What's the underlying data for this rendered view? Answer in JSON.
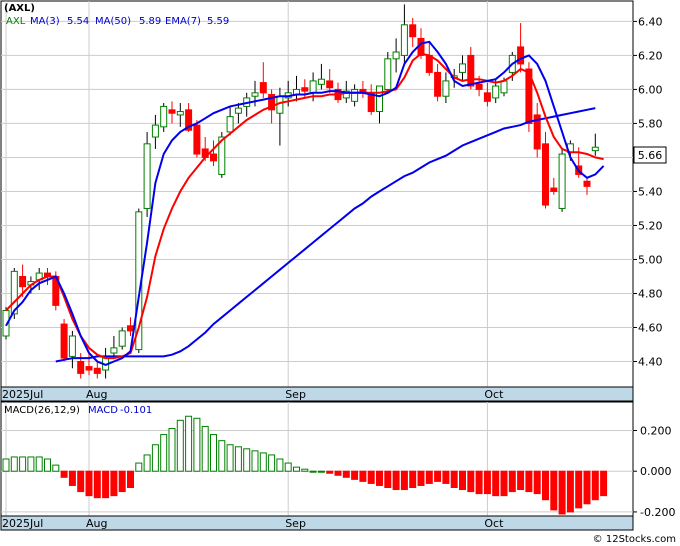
{
  "chart_data": [
    {
      "type": "candlestick",
      "title": "(AXL)",
      "x_labels": [
        "2025Jul",
        "Aug",
        "Sep",
        "Oct"
      ],
      "y_ticks": [
        4.4,
        4.6,
        4.8,
        5.0,
        5.2,
        5.4,
        5.6,
        5.8,
        6.0,
        6.2,
        6.4
      ],
      "ylim": [
        4.25,
        6.52
      ],
      "legend": [
        {
          "name": "AXL",
          "color": "#008000"
        },
        {
          "name": "MA(3)",
          "value": "5.54",
          "color": "#0000cc"
        },
        {
          "name": "MA(50)",
          "value": "5.89",
          "color": "#0000cc"
        },
        {
          "name": "EMA(7)",
          "value": "5.59",
          "color": "#0000cc"
        }
      ],
      "last_price": "5.66",
      "colors": {
        "up": "#008000",
        "down": "#ff0000",
        "ma": "#0000ee",
        "ema": "#ff0000",
        "grid": "#cccccc",
        "axis_band": "#bfd8e8"
      },
      "ohlc": [
        [
          4.55,
          4.72,
          4.53,
          4.7
        ],
        [
          4.68,
          4.95,
          4.65,
          4.93
        ],
        [
          4.9,
          4.97,
          4.78,
          4.84
        ],
        [
          4.85,
          4.9,
          4.8,
          4.87
        ],
        [
          4.88,
          4.95,
          4.82,
          4.92
        ],
        [
          4.92,
          4.95,
          4.85,
          4.9
        ],
        [
          4.9,
          4.93,
          4.7,
          4.73
        ],
        [
          4.62,
          4.65,
          4.4,
          4.42
        ],
        [
          4.43,
          4.58,
          4.36,
          4.55
        ],
        [
          4.4,
          4.45,
          4.3,
          4.33
        ],
        [
          4.37,
          4.45,
          4.32,
          4.35
        ],
        [
          4.36,
          4.4,
          4.3,
          4.33
        ],
        [
          4.35,
          4.48,
          4.3,
          4.42
        ],
        [
          4.45,
          4.55,
          4.42,
          4.48
        ],
        [
          4.49,
          4.6,
          4.47,
          4.58
        ],
        [
          4.61,
          4.66,
          4.55,
          4.58
        ],
        [
          4.47,
          5.3,
          4.45,
          5.28
        ],
        [
          5.3,
          5.75,
          5.25,
          5.68
        ],
        [
          5.72,
          5.85,
          5.65,
          5.79
        ],
        [
          5.78,
          5.92,
          5.75,
          5.9
        ],
        [
          5.88,
          5.93,
          5.8,
          5.86
        ],
        [
          5.85,
          5.92,
          5.78,
          5.87
        ],
        [
          5.88,
          5.92,
          5.75,
          5.76
        ],
        [
          5.79,
          5.82,
          5.6,
          5.62
        ],
        [
          5.65,
          5.72,
          5.58,
          5.6
        ],
        [
          5.62,
          5.7,
          5.55,
          5.58
        ],
        [
          5.5,
          5.75,
          5.48,
          5.72
        ],
        [
          5.75,
          5.9,
          5.73,
          5.84
        ],
        [
          5.86,
          5.92,
          5.8,
          5.89
        ],
        [
          5.9,
          5.98,
          5.84,
          5.95
        ],
        [
          5.96,
          6.05,
          5.9,
          5.98
        ],
        [
          6.04,
          6.16,
          5.95,
          5.98
        ],
        [
          5.97,
          6.0,
          5.8,
          5.88
        ],
        [
          5.86,
          6.01,
          5.67,
          5.96
        ],
        [
          5.95,
          6.05,
          5.9,
          5.98
        ],
        [
          5.97,
          6.08,
          5.93,
          6.0
        ],
        [
          6.01,
          6.06,
          5.95,
          5.99
        ],
        [
          5.98,
          6.1,
          5.93,
          6.05
        ],
        [
          6.03,
          6.15,
          6.0,
          6.06
        ],
        [
          6.05,
          6.12,
          5.98,
          6.01
        ],
        [
          6.0,
          6.04,
          5.92,
          5.94
        ],
        [
          5.95,
          6.05,
          5.92,
          5.99
        ],
        [
          5.93,
          6.03,
          5.9,
          6.0
        ],
        [
          6.0,
          6.05,
          5.95,
          5.98
        ],
        [
          5.98,
          6.03,
          5.85,
          5.87
        ],
        [
          5.87,
          6.02,
          5.8,
          6.02
        ],
        [
          6.0,
          6.22,
          5.98,
          6.18
        ],
        [
          6.18,
          6.3,
          6.1,
          6.22
        ],
        [
          6.2,
          6.5,
          6.15,
          6.38
        ],
        [
          6.38,
          6.42,
          6.25,
          6.31
        ],
        [
          6.3,
          6.36,
          6.18,
          6.2
        ],
        [
          6.2,
          6.28,
          6.08,
          6.1
        ],
        [
          6.1,
          6.15,
          5.93,
          5.96
        ],
        [
          5.96,
          6.1,
          5.92,
          6.05
        ],
        [
          6.07,
          6.12,
          6.01,
          6.08
        ],
        [
          6.1,
          6.2,
          6.05,
          6.15
        ],
        [
          6.2,
          6.25,
          6.0,
          6.02
        ],
        [
          6.03,
          6.08,
          5.96,
          6.0
        ],
        [
          5.98,
          6.04,
          5.9,
          5.93
        ],
        [
          5.95,
          6.06,
          5.92,
          6.02
        ],
        [
          5.98,
          6.07,
          5.96,
          6.05
        ],
        [
          6.1,
          6.22,
          6.05,
          6.2
        ],
        [
          6.25,
          6.39,
          6.1,
          6.15
        ],
        [
          6.12,
          6.16,
          5.75,
          5.8
        ],
        [
          5.85,
          5.92,
          5.6,
          5.65
        ],
        [
          5.68,
          5.75,
          5.3,
          5.32
        ],
        [
          5.42,
          5.48,
          5.38,
          5.4
        ],
        [
          5.3,
          5.65,
          5.28,
          5.62
        ],
        [
          5.63,
          5.7,
          5.58,
          5.68
        ],
        [
          5.55,
          5.66,
          5.48,
          5.5
        ],
        [
          5.46,
          5.48,
          5.38,
          5.43
        ],
        [
          5.64,
          5.74,
          5.61,
          5.66
        ]
      ],
      "ma3": [
        4.61,
        4.7,
        4.75,
        4.82,
        4.86,
        4.88,
        4.9,
        4.8,
        4.68,
        4.55,
        4.45,
        4.4,
        4.38,
        4.4,
        4.42,
        4.46,
        4.78,
        5.1,
        5.45,
        5.62,
        5.7,
        5.75,
        5.78,
        5.8,
        5.83,
        5.86,
        5.88,
        5.9,
        5.91,
        5.92,
        5.93,
        5.94,
        5.95,
        5.96,
        5.96,
        5.97,
        5.97,
        5.98,
        5.98,
        5.99,
        5.99,
        5.98,
        5.98,
        5.98,
        5.97,
        5.96,
        5.98,
        6.01,
        6.15,
        6.22,
        6.27,
        6.28,
        6.22,
        6.15,
        6.05,
        6.02,
        6.03,
        6.04,
        6.05,
        6.06,
        6.1,
        6.15,
        6.18,
        6.2,
        6.15,
        6.05,
        5.9,
        5.75,
        5.6,
        5.52,
        5.48,
        5.5,
        5.55
      ],
      "ma50": [
        4.4,
        4.41,
        4.42,
        4.42,
        4.42,
        4.43,
        4.43,
        4.43,
        4.43,
        4.43,
        4.43,
        4.43,
        4.43,
        4.43,
        4.44,
        4.46,
        4.49,
        4.53,
        4.57,
        4.62,
        4.66,
        4.7,
        4.74,
        4.78,
        4.82,
        4.86,
        4.9,
        4.94,
        4.98,
        5.02,
        5.06,
        5.1,
        5.14,
        5.18,
        5.22,
        5.26,
        5.3,
        5.33,
        5.37,
        5.4,
        5.43,
        5.46,
        5.49,
        5.51,
        5.54,
        5.57,
        5.59,
        5.61,
        5.64,
        5.67,
        5.69,
        5.71,
        5.73,
        5.75,
        5.77,
        5.78,
        5.79,
        5.81,
        5.82,
        5.83,
        5.84,
        5.85,
        5.86,
        5.87,
        5.88,
        5.89
      ],
      "ema7": [
        4.7,
        4.75,
        4.8,
        4.85,
        4.88,
        4.9,
        4.9,
        4.78,
        4.65,
        4.55,
        4.48,
        4.44,
        4.42,
        4.42,
        4.43,
        4.45,
        4.6,
        4.78,
        5.02,
        5.18,
        5.3,
        5.4,
        5.48,
        5.54,
        5.6,
        5.65,
        5.7,
        5.74,
        5.78,
        5.82,
        5.85,
        5.88,
        5.9,
        5.92,
        5.93,
        5.94,
        5.95,
        5.96,
        5.96,
        5.97,
        5.97,
        5.98,
        5.98,
        5.98,
        5.98,
        5.98,
        5.99,
        6.0,
        6.07,
        6.17,
        6.21,
        6.2,
        6.17,
        6.12,
        6.07,
        6.05,
        6.06,
        6.06,
        6.05,
        6.04,
        6.05,
        6.08,
        6.12,
        6.1,
        5.98,
        5.84,
        5.72,
        5.65,
        5.63,
        5.63,
        5.62,
        5.6,
        5.59
      ]
    },
    {
      "type": "bar",
      "title": "MACD(26,12,9)",
      "legend": [
        {
          "name": "MACD",
          "value": "-0.101",
          "color": "#0000cc"
        }
      ],
      "x_labels": [
        "2025Jul",
        "Aug",
        "Sep",
        "Oct"
      ],
      "y_ticks": [
        "0.200",
        "0.000",
        "-0.200"
      ],
      "ylim": [
        -0.22,
        0.34
      ],
      "values": [
        0.06,
        0.07,
        0.07,
        0.07,
        0.07,
        0.06,
        0.03,
        -0.03,
        -0.07,
        -0.1,
        -0.12,
        -0.13,
        -0.13,
        -0.12,
        -0.1,
        -0.08,
        0.04,
        0.08,
        0.13,
        0.18,
        0.21,
        0.25,
        0.27,
        0.26,
        0.22,
        0.18,
        0.15,
        0.13,
        0.12,
        0.11,
        0.1,
        0.09,
        0.08,
        0.06,
        0.04,
        0.02,
        0.01,
        0.0,
        0.0,
        -0.01,
        -0.02,
        -0.03,
        -0.04,
        -0.05,
        -0.06,
        -0.07,
        -0.08,
        -0.09,
        -0.09,
        -0.08,
        -0.07,
        -0.06,
        -0.05,
        -0.06,
        -0.08,
        -0.09,
        -0.1,
        -0.11,
        -0.11,
        -0.12,
        -0.12,
        -0.1,
        -0.09,
        -0.1,
        -0.11,
        -0.14,
        -0.19,
        -0.21,
        -0.2,
        -0.18,
        -0.16,
        -0.14,
        -0.12
      ]
    }
  ],
  "watermark": "© 12Stocks.com"
}
